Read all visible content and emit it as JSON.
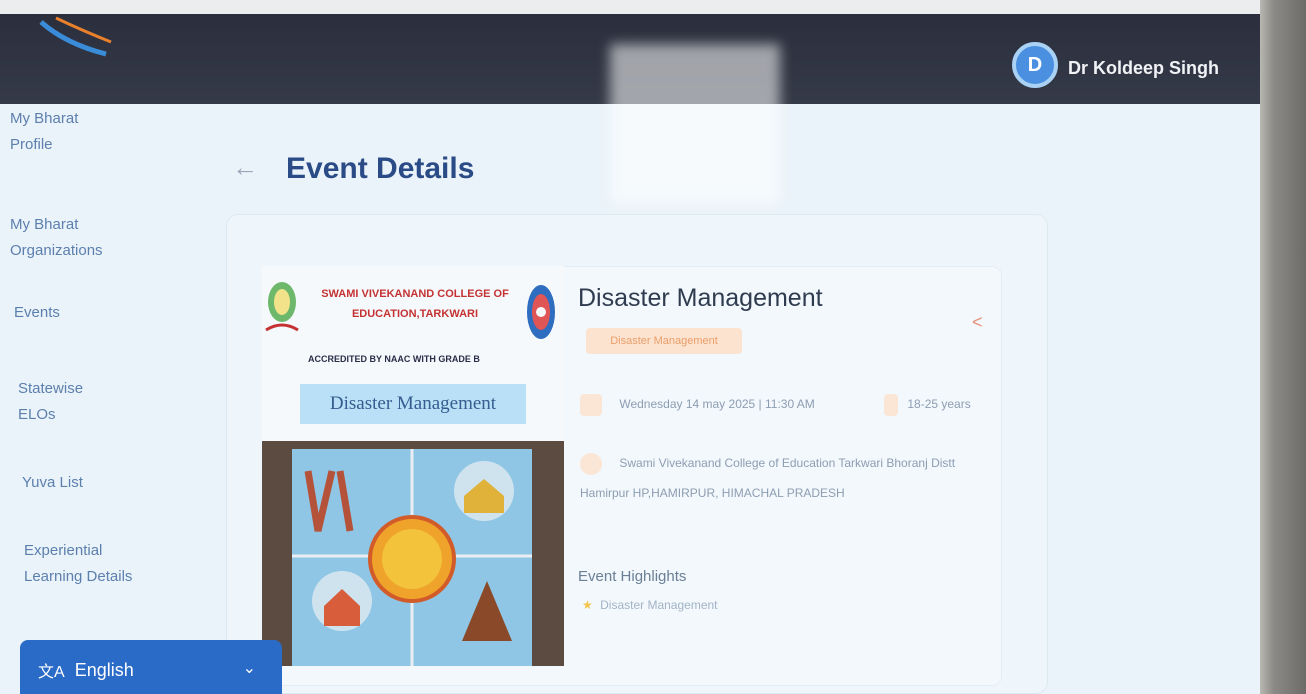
{
  "header": {
    "avatar_letter": "D",
    "user_name": "Dr Koldeep Singh"
  },
  "sidebar": {
    "items": [
      {
        "label": "My Bharat Profile"
      },
      {
        "label": "My Bharat Organizations"
      },
      {
        "label": "Events"
      },
      {
        "label": "Statewise ELOs"
      },
      {
        "label": "Yuva List"
      },
      {
        "label": "Experiential Learning Details"
      }
    ],
    "language": {
      "label": "English"
    }
  },
  "page": {
    "title": "Event Details"
  },
  "event": {
    "poster": {
      "college": "SWAMI VIVEKANAND COLLEGE OF EDUCATION,TARKWARI",
      "accredited": "ACCREDITED BY NAAC WITH GRADE B",
      "title": "Disaster Management"
    },
    "title": "Disaster Management",
    "tag": "Disaster Management",
    "date": "Wednesday 14 may 2025 | 11:30 AM",
    "age": "18-25 years",
    "location": "Swami Vivekanand College of Education Tarkwari Bhoranj Distt Hamirpur HP,HAMIRPUR, HIMACHAL PRADESH",
    "highlights_heading": "Event Highlights",
    "highlight": "Disaster Management"
  },
  "colors": {
    "topbar": "#2b2f3d",
    "accent": "#2a6bc7",
    "title": "#2a4b86"
  },
  "icons": {
    "back": "back-arrow-icon",
    "share": "share-icon",
    "calendar": "calendar-icon",
    "age": "person-icon",
    "location": "location-pin-icon",
    "star": "star-icon",
    "translate": "translate-icon",
    "dropdown": "chevron-down-icon"
  }
}
